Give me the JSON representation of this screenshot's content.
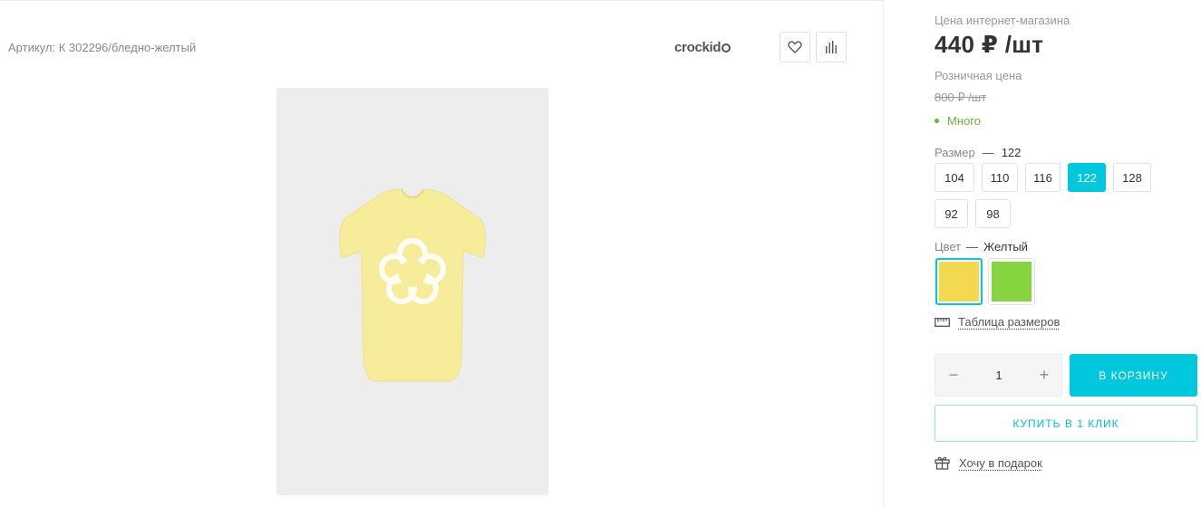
{
  "product": {
    "article": "Артикул: К 302296/бледно-желтый",
    "brand": "crockid",
    "photo_bg": "#ededed",
    "shirt_color": "#f6ec9a",
    "favorite_icon": "heart-icon",
    "compare_icon": "bar-chart-icon"
  },
  "pricing": {
    "online_label": "Цена интернет-магазина",
    "online_price": "440 ₽ /шт",
    "retail_label": "Розничная цена",
    "retail_price": "800 ₽ /шт",
    "stock": "Много",
    "stock_color": "#6cb33a"
  },
  "size": {
    "label": "Размер",
    "dash": "—",
    "selected": "122",
    "options": [
      "104",
      "110",
      "116",
      "122",
      "128",
      "92",
      "98"
    ]
  },
  "color": {
    "label": "Цвет",
    "dash": "—",
    "selected": "Желтый",
    "swatches": [
      "#f3d94f",
      "#86d440"
    ]
  },
  "size_table": {
    "label": "Таблица размеров",
    "icon": "ruler-icon"
  },
  "quantity": {
    "value": "1",
    "minus": "−",
    "plus": "+"
  },
  "actions": {
    "cart": "В КОРЗИНУ",
    "one_click": "КУПИТЬ В 1 КЛИК",
    "gift": "Хочу в подарок",
    "gift_icon": "gift-icon"
  },
  "colors": {
    "accent": "#00c8dc"
  }
}
